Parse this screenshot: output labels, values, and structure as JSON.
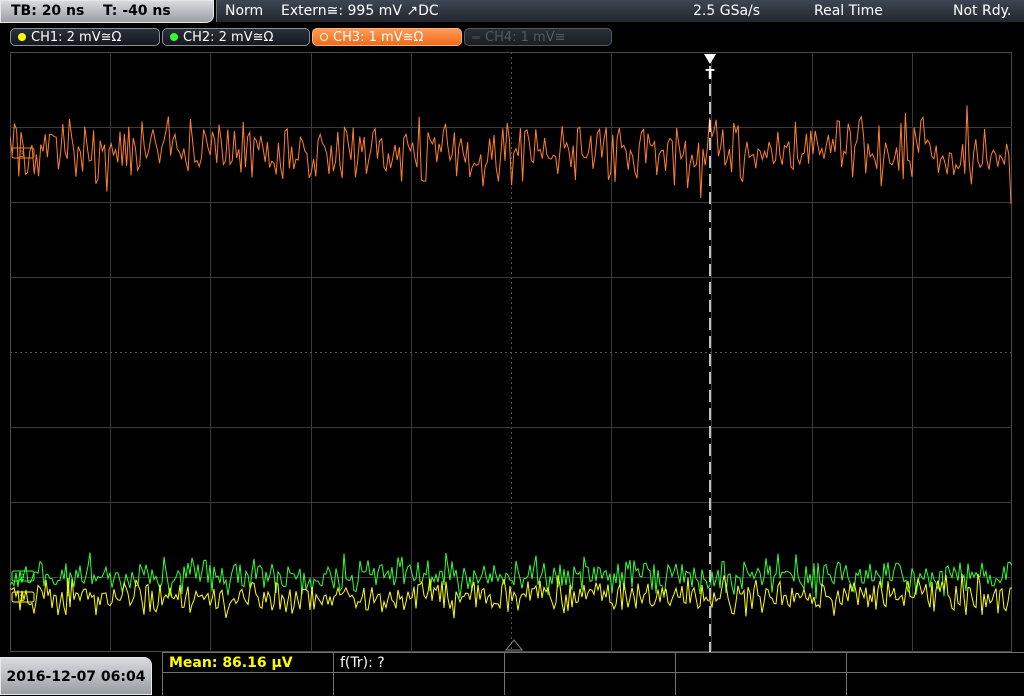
{
  "timebase": {
    "tb": "TB: 20 ns",
    "trig_pos": "T: -40 ns"
  },
  "status": {
    "mode": "Norm",
    "trigger": "Extern≅: 995 mV ↗DC",
    "sample_rate": "2.5 GSa/s",
    "acq_mode": "Real Time",
    "state": "Not Rdy."
  },
  "channels": [
    {
      "label": "CH1: 2 mV≅Ω",
      "color": "#ffff00",
      "state": "on"
    },
    {
      "label": "CH2: 2 mV≅Ω",
      "color": "#33ff33",
      "state": "on"
    },
    {
      "label": "CH3: 1 mV≅Ω",
      "color": "#ff7f2a",
      "state": "selected"
    },
    {
      "label": "CH4: 1 mV≅",
      "color": "#5a5f66",
      "state": "off"
    }
  ],
  "markers": {
    "ch1": "1",
    "ch2": "2",
    "ch3": "3",
    "trigger": "T"
  },
  "datetime": "2016-12-07 06:04",
  "measurements": {
    "mean": "Mean: 86.16 µV",
    "freq": "f(Tr): ?"
  },
  "colors": {
    "grid": "#3a3a3a",
    "grid_center": "#555555",
    "background": "#000000"
  }
}
